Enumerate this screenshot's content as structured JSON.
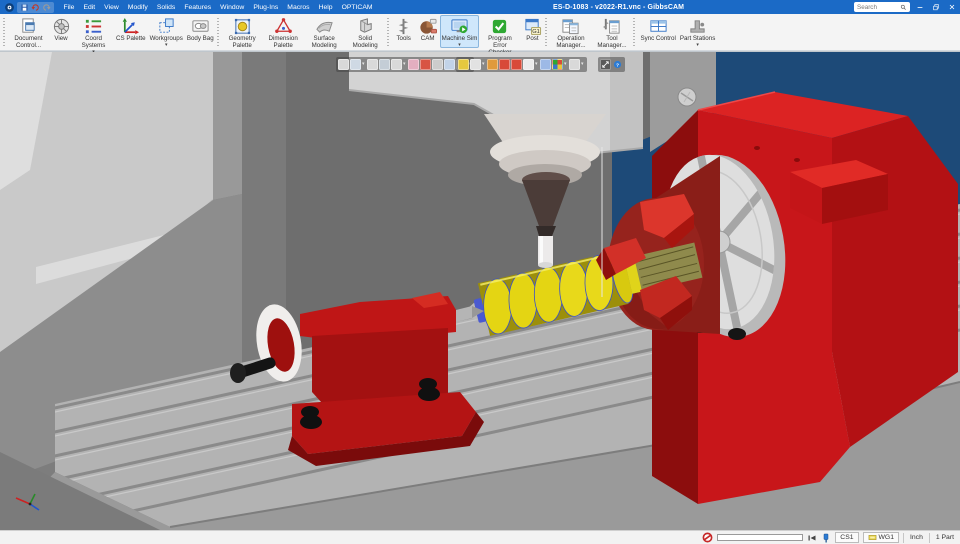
{
  "window": {
    "title": "ES-D-1083 - v2022-R1.vnc - GibbsCAM",
    "search_placeholder": "Search"
  },
  "menus": [
    "File",
    "Edit",
    "View",
    "Modify",
    "Solids",
    "Features",
    "Window",
    "Plug-Ins",
    "Macros",
    "Help",
    "OPTICAM"
  ],
  "quick_access": [
    {
      "name": "save",
      "icon": "save"
    },
    {
      "name": "undo",
      "icon": "undo"
    },
    {
      "name": "redo",
      "icon": "redo"
    }
  ],
  "ribbon": {
    "groups": [
      {
        "name": "workspace",
        "items": [
          {
            "label": "Document Control...",
            "icon": "document-control"
          },
          {
            "label": "View",
            "icon": "view"
          },
          {
            "label": "Coord Systems",
            "icon": "coord-systems",
            "caret": true
          },
          {
            "label": "CS Palette",
            "icon": "cs-palette"
          },
          {
            "label": "Workgroups",
            "icon": "workgroups",
            "caret": true
          },
          {
            "label": "Body Bag",
            "icon": "body-bag"
          }
        ]
      },
      {
        "name": "modeling",
        "items": [
          {
            "label": "Geometry Palette",
            "icon": "geometry-palette"
          },
          {
            "label": "Dimension Palette",
            "icon": "dimension-palette"
          },
          {
            "label": "Surface Modeling",
            "icon": "surface-modeling"
          },
          {
            "label": "Solid Modeling",
            "icon": "solid-modeling"
          }
        ]
      },
      {
        "name": "machining",
        "items": [
          {
            "label": "Tools",
            "icon": "tools"
          },
          {
            "label": "CAM",
            "icon": "cam"
          },
          {
            "label": "Machine Sim",
            "icon": "machine-sim",
            "selected": true,
            "caret": true
          },
          {
            "label": "Program Error Checker",
            "icon": "program-error-checker"
          },
          {
            "label": "Post",
            "icon": "post"
          }
        ]
      },
      {
        "name": "managers",
        "items": [
          {
            "label": "Operation Manager...",
            "icon": "operation-manager"
          },
          {
            "label": "Tool Manager...",
            "icon": "tool-manager"
          }
        ]
      },
      {
        "name": "sync",
        "items": [
          {
            "label": "Sync Control",
            "icon": "sync-control"
          },
          {
            "label": "Part Stations",
            "icon": "part-stations",
            "caret": true
          }
        ]
      }
    ]
  },
  "viewport": {
    "float_toolbars": [
      {
        "name": "view-toolbar",
        "icons": [
          {
            "c": "#d9d9d9"
          },
          {
            "c": "#cfd9e4",
            "caret": true
          },
          {
            "c": "#d9d9d9"
          },
          {
            "c": "#c4cdd6"
          },
          {
            "c": "#d9d9d9",
            "caret": true
          },
          {
            "c": "#e3aec0"
          },
          {
            "c": "#d85443"
          },
          {
            "c": "#cccccc"
          },
          {
            "c": "#c2d3e8"
          },
          {
            "c": "#d9d9d9",
            "caret": true
          }
        ]
      },
      {
        "name": "display-toolbar",
        "icons": [
          {
            "c": "#e6c83e"
          },
          {
            "c": "#e2e2e2",
            "caret": true
          },
          {
            "c": "#e09a3c"
          },
          {
            "c": "#d84a38"
          },
          {
            "c": "#d84a38"
          },
          {
            "c": "#ececec",
            "caret": true
          },
          {
            "c": "#9db9e6"
          },
          {
            "c": "pie",
            "caret": true
          },
          {
            "c": "#d9d9d9",
            "caret": true
          }
        ]
      },
      {
        "name": "sim-toolbar",
        "icons": [
          {
            "c": "resize"
          },
          {
            "c": "help"
          }
        ]
      }
    ]
  },
  "status_bar": {
    "cs": "CS1",
    "wg": "WG1",
    "units": "Inch",
    "parts": "1 Part"
  },
  "colors": {
    "titlebar": "#1b6ac6",
    "ribbon_selected": "#cfe7fb",
    "machine_red": "#c8161a",
    "machine_dark_red": "#8c0d0d",
    "machine_blue": "#1d4a78",
    "workpiece_yellow": "#e4d513",
    "toolpath_blue": "#4356d6",
    "table_gray": "#b3b3b3",
    "status_alert_red": "#c62828"
  }
}
